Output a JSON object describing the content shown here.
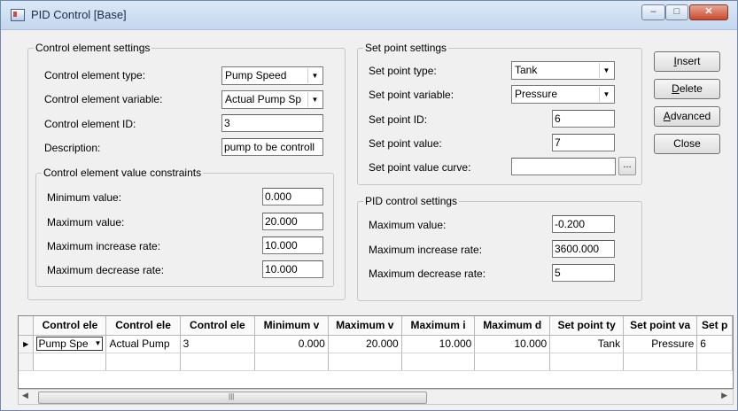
{
  "window": {
    "title": "PID Control [Base]",
    "min": "–",
    "max": "□",
    "close": "✕"
  },
  "control_element": {
    "legend": "Control element settings",
    "type_label": "Control element type:",
    "type_value": "Pump Speed",
    "variable_label": "Control element variable:",
    "variable_value": "Actual Pump Sp",
    "id_label": "Control element ID:",
    "id_value": "3",
    "desc_label": "Description:",
    "desc_value": "pump to be controll",
    "constraints": {
      "legend": "Control element value constraints",
      "min_label": "Minimum value:",
      "min_value": "0.000",
      "max_label": "Maximum value:",
      "max_value": "20.000",
      "inc_label": "Maximum increase rate:",
      "inc_value": "10.000",
      "dec_label": "Maximum decrease rate:",
      "dec_value": "10.000"
    }
  },
  "set_point": {
    "legend": "Set point settings",
    "type_label": "Set point type:",
    "type_value": "Tank",
    "variable_label": "Set point variable:",
    "variable_value": "Pressure",
    "id_label": "Set point ID:",
    "id_value": "6",
    "value_label": "Set point value:",
    "value_value": "7",
    "curve_label": "Set point value curve:",
    "curve_value": "",
    "curve_button": "..."
  },
  "pid": {
    "legend": "PID control settings",
    "max_label": "Maximum value:",
    "max_value": "-0.200",
    "inc_label": "Maximum increase rate:",
    "inc_value": "3600.000",
    "dec_label": "Maximum decrease rate:",
    "dec_value": "5"
  },
  "buttons": {
    "insert": {
      "key": "I",
      "rest": "nsert"
    },
    "delete": {
      "key": "D",
      "rest": "elete"
    },
    "advanced": {
      "key": "A",
      "rest": "dvanced"
    },
    "close": "Close"
  },
  "grid": {
    "columns": [
      "Control ele",
      "Control ele",
      "Control ele",
      "Minimum v",
      "Maximum v",
      "Maximum i",
      "Maximum d",
      "Set point ty",
      "Set point va",
      "Set p"
    ],
    "rows": [
      [
        "Pump Spe",
        "Actual Pump",
        "3",
        "0.000",
        "20.000",
        "10.000",
        "10.000",
        "Tank",
        "Pressure",
        "6"
      ]
    ]
  },
  "scrollbar": {
    "grip": "|||"
  }
}
